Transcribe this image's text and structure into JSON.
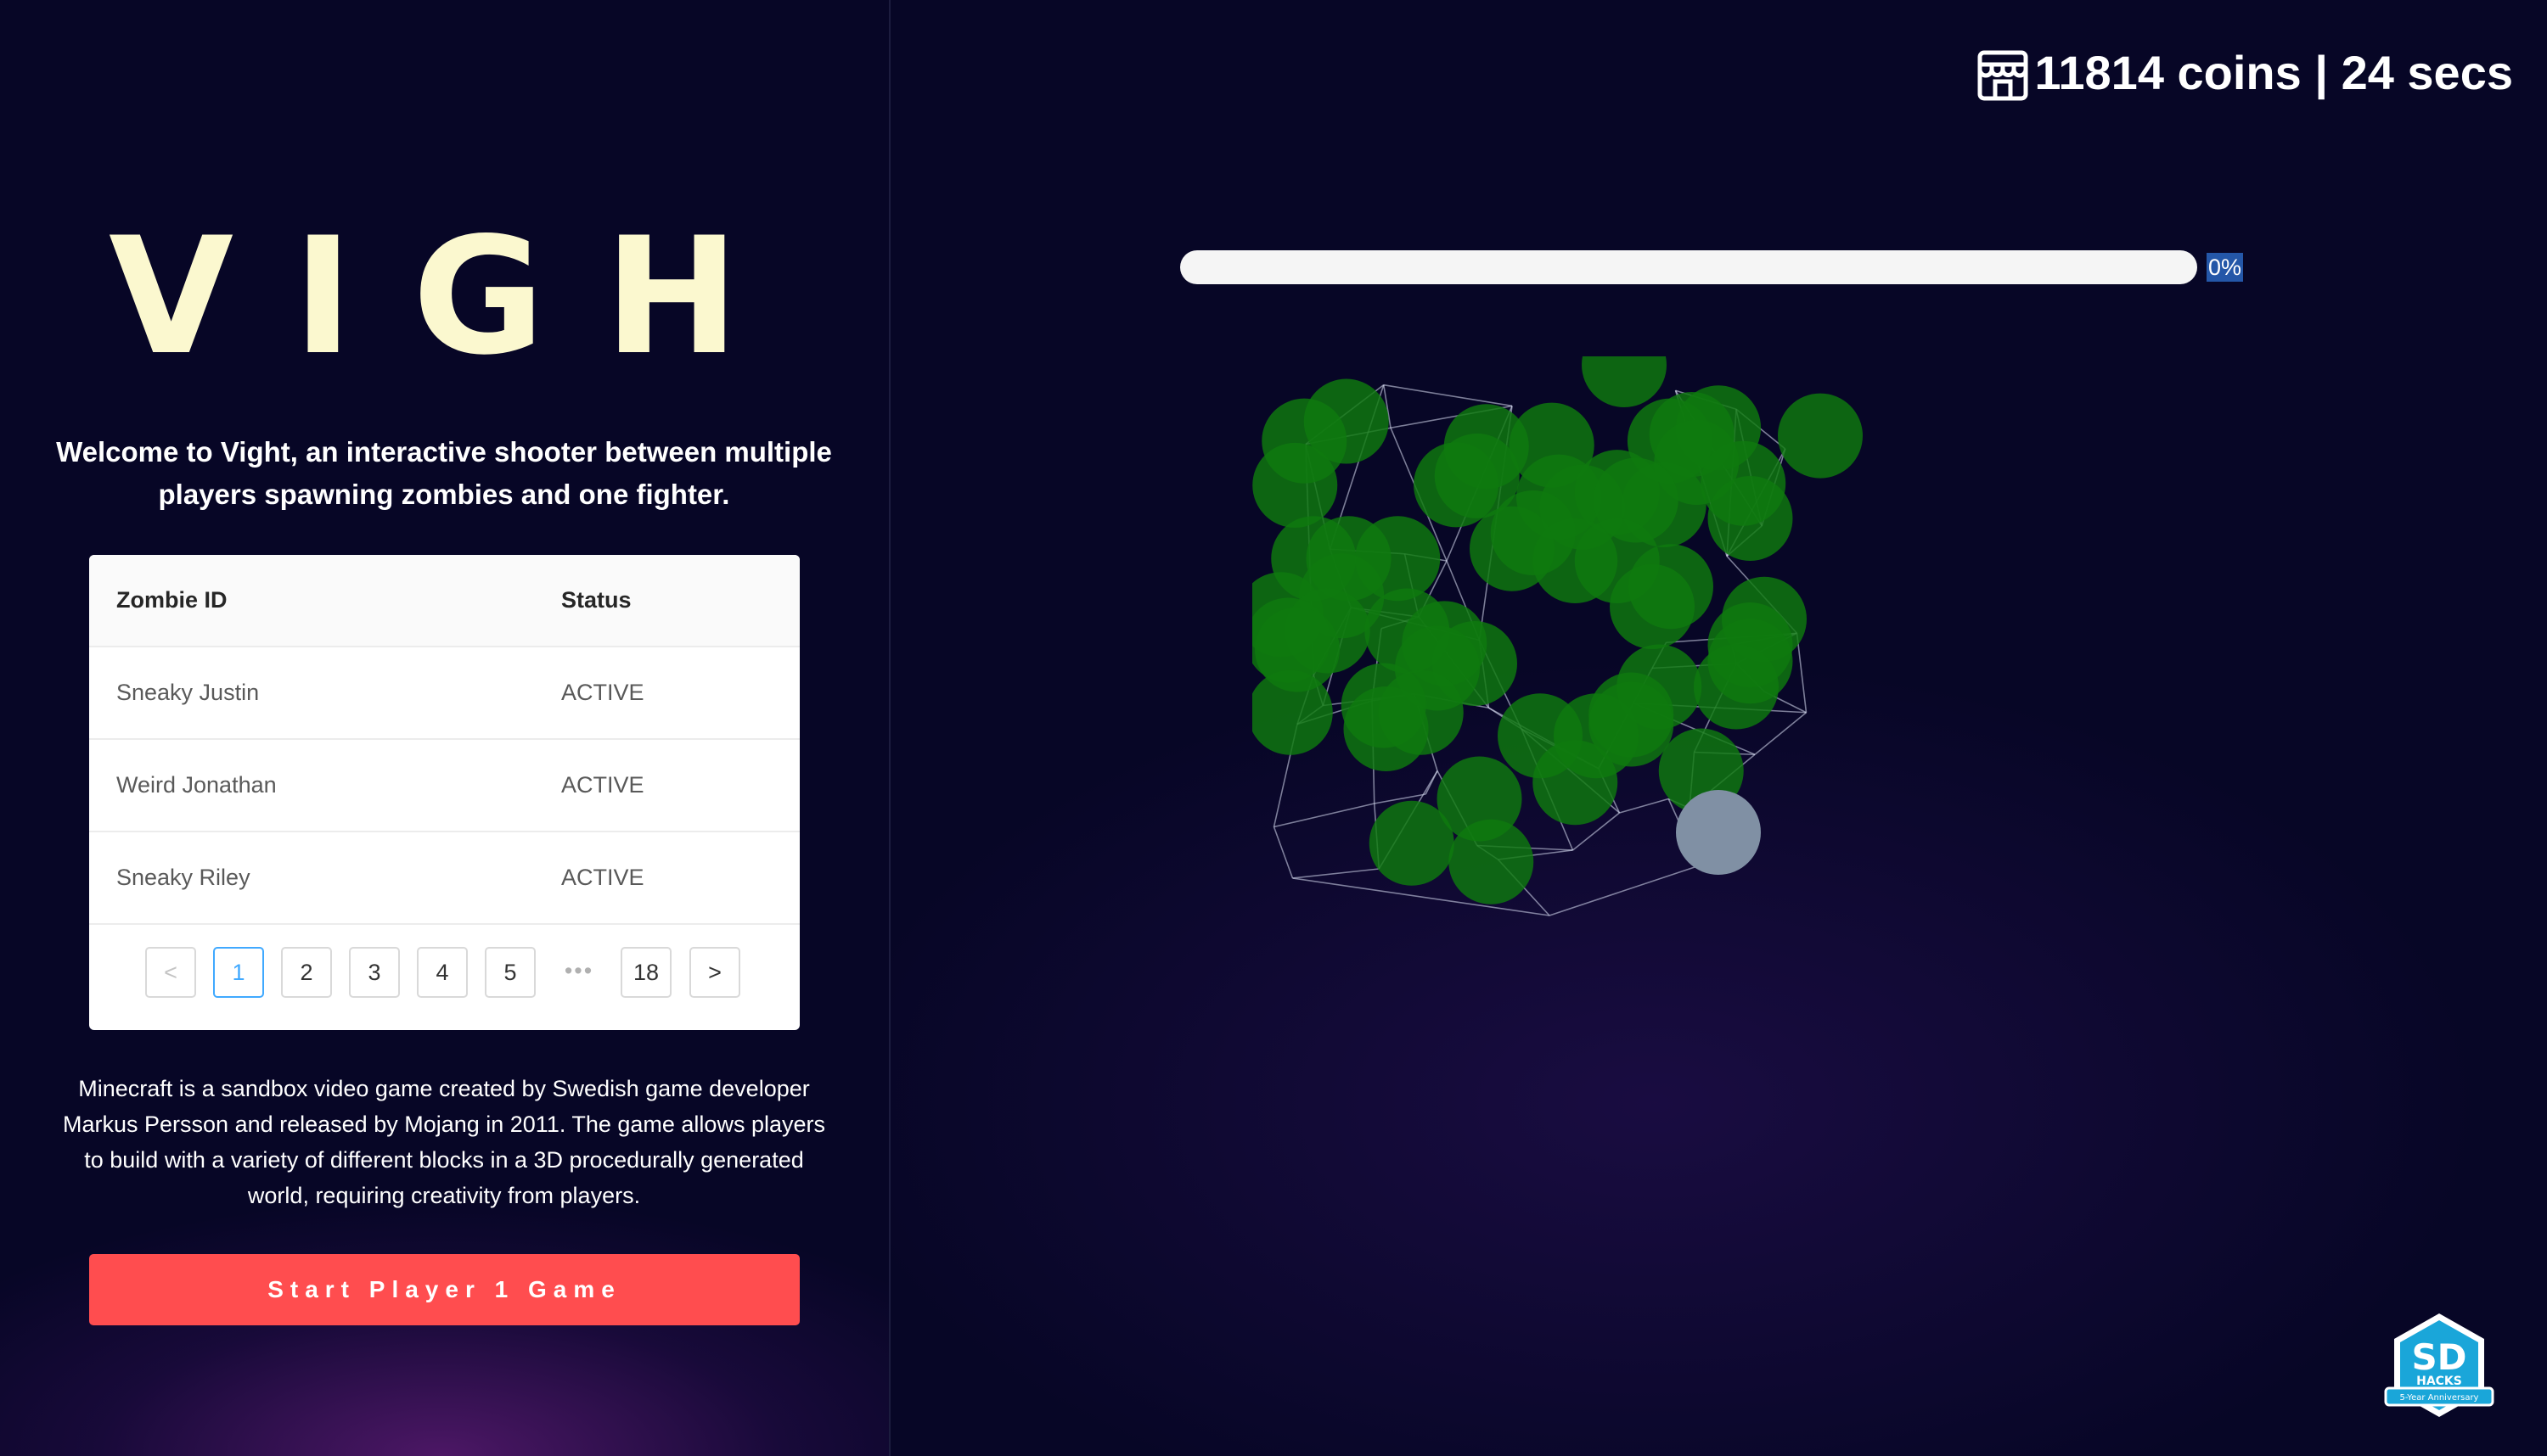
{
  "app": {
    "logo_text": "VIGHT",
    "intro": "Welcome to Vight, an interactive shooter between multiple players spawning zombies and one fighter.",
    "description": "Minecraft is a sandbox video game created by Swedish game developer Markus Persson and released by Mojang in 2011. The game allows players to build with a variety of different blocks in a 3D procedurally generated world, requiring creativity from players.",
    "start_button": "Start Player 1 Game"
  },
  "table": {
    "headers": [
      "Zombie ID",
      "Status"
    ],
    "rows": [
      {
        "id": "Sneaky Justin",
        "status": "ACTIVE"
      },
      {
        "id": "Weird Jonathan",
        "status": "ACTIVE"
      },
      {
        "id": "Sneaky Riley",
        "status": "ACTIVE"
      }
    ],
    "pagination": {
      "prev": "<",
      "next": ">",
      "pages": [
        "1",
        "2",
        "3",
        "4",
        "5"
      ],
      "ellipsis": "•••",
      "last": "18",
      "current": "1"
    }
  },
  "hud": {
    "coins_time": "11814 coins | 24 secs",
    "store_icon": "store-icon"
  },
  "progress": {
    "label": "0%",
    "value": 0
  },
  "game": {
    "zombie_color": "#0f7a0f",
    "player_color": "#8090a4"
  },
  "badge": {
    "title": "SD",
    "subtitle": "HACKS",
    "tagline": "5-Year Anniversary"
  }
}
